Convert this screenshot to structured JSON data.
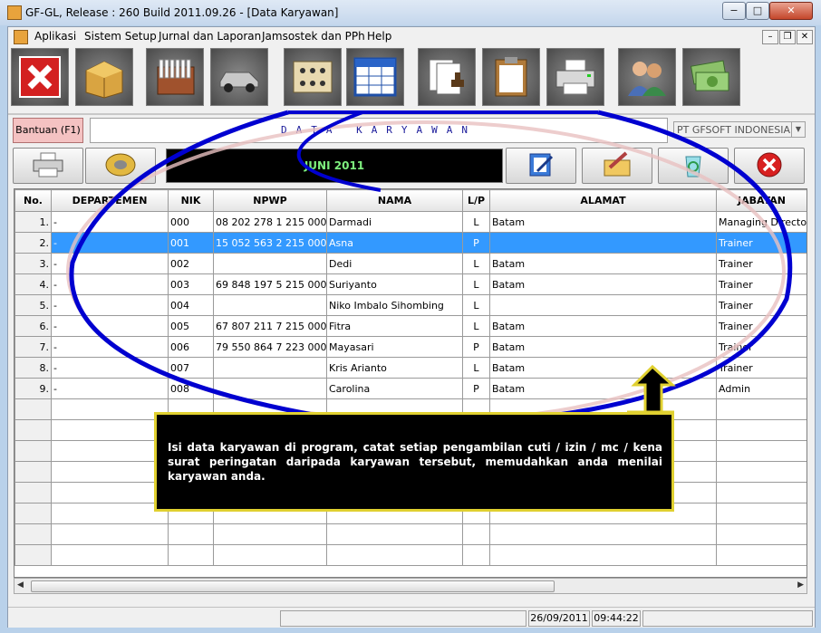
{
  "window": {
    "title": "GF-GL, Release : 260 Build 2011.09.26 - [Data Karyawan]",
    "minimize": "−",
    "maximize": "□",
    "close": "✕"
  },
  "menu": [
    "Aplikasi",
    "Sistem Setup",
    "Jurnal dan Laporan",
    "Jamsostek dan PPh",
    "Help"
  ],
  "mdi": {
    "minimize": "–",
    "restore": "❐",
    "close": "✕"
  },
  "toolbar_icons": [
    "close-app-icon",
    "zip-archive-icon",
    "card-file-icon",
    "car-icon",
    "cashier-icon",
    "spreadsheet-icon",
    "documents-stamp-icon",
    "clipboard-icon",
    "printer-icon",
    "users-icon",
    "money-icon"
  ],
  "help_label": "Bantuan (F1)",
  "form_title": "DATA KARYAWAN",
  "company": {
    "value": "PT GFSOFT INDONESIA",
    "arrow": "▼"
  },
  "period": "JUNI 2011",
  "table": {
    "headers": [
      "No.",
      "DEPARTEMEN",
      "NIK",
      "NPWP",
      "NAMA",
      "L/P",
      "ALAMAT",
      "JABATAN"
    ],
    "rows": [
      [
        "1.",
        "-",
        "000",
        "08 202 278 1 215 000",
        "Darmadi",
        "L",
        "Batam",
        "Managing Director"
      ],
      [
        "2.",
        "-",
        "001",
        "15 052 563 2 215 000",
        "Asna",
        "P",
        "",
        "Trainer"
      ],
      [
        "3.",
        "-",
        "002",
        "",
        "Dedi",
        "L",
        "Batam",
        "Trainer"
      ],
      [
        "4.",
        "-",
        "003",
        "69 848 197 5 215 000",
        "Suriyanto",
        "L",
        "Batam",
        "Trainer"
      ],
      [
        "5.",
        "-",
        "004",
        "",
        "Niko Imbalo Sihombing",
        "L",
        "",
        "Trainer"
      ],
      [
        "6.",
        "-",
        "005",
        "67 807 211 7 215 000",
        "Fitra",
        "L",
        "Batam",
        "Trainer"
      ],
      [
        "7.",
        "-",
        "006",
        "79 550 864 7 223 000",
        "Mayasari",
        "P",
        "Batam",
        "Trainer"
      ],
      [
        "8.",
        "-",
        "007",
        "",
        "Kris Arianto",
        "L",
        "Batam",
        "Trainer"
      ],
      [
        "9.",
        "-",
        "008",
        "",
        "Carolina",
        "P",
        "Batam",
        "Admin"
      ],
      [
        "",
        "",
        "",
        "",
        "",
        "",
        "",
        ""
      ],
      [
        "",
        "",
        "",
        "",
        "",
        "",
        "",
        ""
      ],
      [
        "",
        "",
        "",
        "",
        "",
        "",
        "",
        ""
      ],
      [
        "",
        "",
        "",
        "",
        "",
        "",
        "",
        ""
      ],
      [
        "",
        "",
        "",
        "",
        "",
        "",
        "",
        ""
      ],
      [
        "",
        "",
        "",
        "",
        "",
        "",
        "",
        ""
      ],
      [
        "",
        "",
        "",
        "",
        "",
        "",
        "",
        ""
      ],
      [
        "",
        "",
        "",
        "",
        "",
        "",
        "",
        ""
      ]
    ],
    "selected_row": 1
  },
  "scroll": {
    "left": "◀",
    "right": "▶"
  },
  "status": {
    "date": "26/09/2011",
    "time": "09:44:22"
  },
  "callout": "Isi data karyawan di program, catat setiap pengambilan cuti / izin / mc / kena surat peringatan daripada karyawan tersebut, memudahkan anda menilai karyawan anda.",
  "colors": {
    "selection": "#3399ff",
    "period_text": "#7ef07e",
    "callout_border": "#e0d030",
    "annotation": "#0000d0"
  }
}
